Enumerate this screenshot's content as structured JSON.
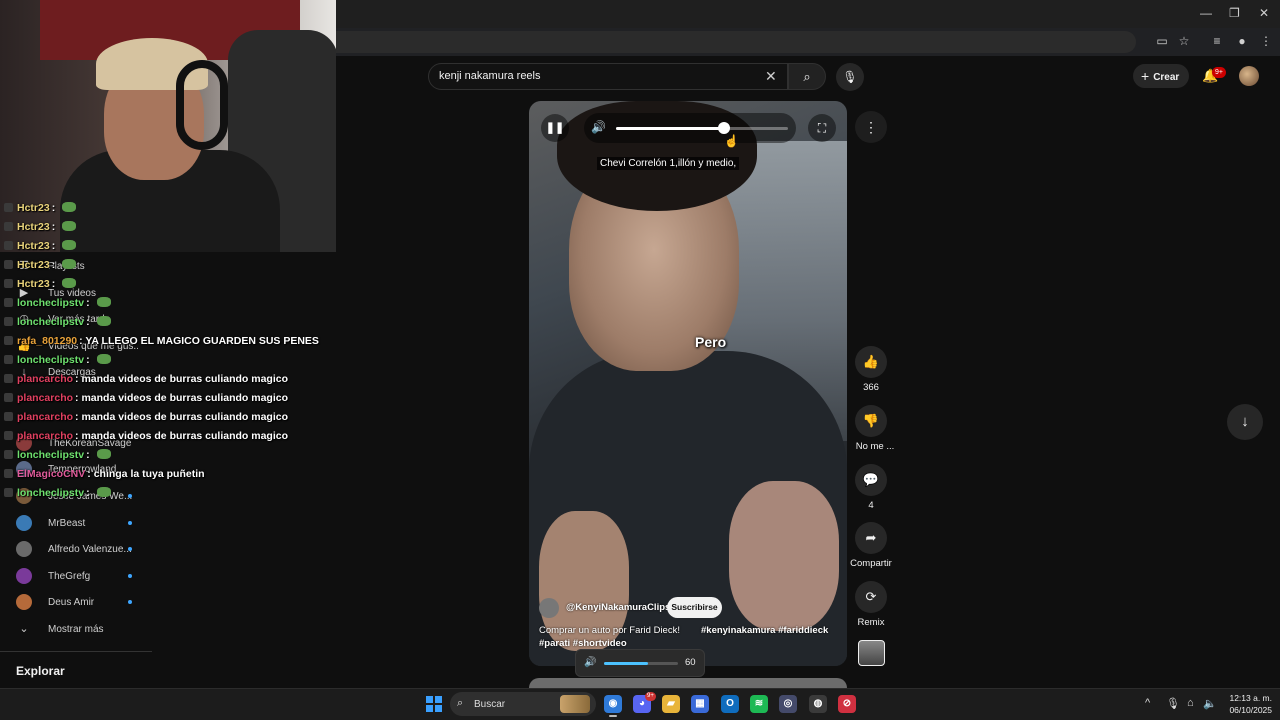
{
  "window": {
    "minimize": "—",
    "maximize": "❐",
    "close": "✕"
  },
  "search": {
    "query": "kenji nakamura reels",
    "clear_icon": "✕",
    "search_icon": "⌕",
    "mic_icon": "🎙"
  },
  "header": {
    "create_label": "Crear",
    "create_plus": "+",
    "notifications_badge": "9+"
  },
  "sidebar": {
    "items": [
      {
        "label": "Playlists",
        "icon": "☰"
      },
      {
        "label": "Tus videos",
        "icon": "▶"
      },
      {
        "label": "Ver más tarde",
        "icon": "◷"
      },
      {
        "label": "Videos que me gus...",
        "icon": "👍"
      },
      {
        "label": "Descargas",
        "icon": "↓"
      }
    ],
    "subscriptions": [
      {
        "label": "TheKoreanSavage",
        "color": "#8a3b3b"
      },
      {
        "label": "Temperrowland",
        "color": "#5a6a8a"
      },
      {
        "label": "Jesse James We...",
        "color": "#7a5a3a"
      },
      {
        "label": "MrBeast",
        "color": "#3a7ab5"
      },
      {
        "label": "Alfredo Valenzue...",
        "color": "#6a6a6a"
      },
      {
        "label": "TheGrefg",
        "color": "#7a3a9a"
      },
      {
        "label": "Deus Amir",
        "color": "#b56a3a"
      }
    ],
    "show_more": "Mostrar más",
    "show_more_icon": "⌄",
    "explore": "Explorar"
  },
  "chat": [
    {
      "user": "Hctr23",
      "color": "#e8d27a",
      "message": ""
    },
    {
      "user": "Hctr23",
      "color": "#e8d27a",
      "message": ""
    },
    {
      "user": "Hctr23",
      "color": "#e8d27a",
      "message": ""
    },
    {
      "user": "Hctr23",
      "color": "#e8d27a",
      "message": ""
    },
    {
      "user": "Hctr23",
      "color": "#e8d27a",
      "message": ""
    },
    {
      "user": "loncheclipstv",
      "color": "#6ee06e",
      "message": ""
    },
    {
      "user": "loncheclipstv",
      "color": "#6ee06e",
      "message": ""
    },
    {
      "user": "rafa_801290",
      "color": "#e8a23a",
      "message": "YA LLEGO EL MAGICO GUARDEN SUS PENES"
    },
    {
      "user": "loncheclipstv",
      "color": "#6ee06e",
      "message": ""
    },
    {
      "user": "plancarcho",
      "color": "#e04060",
      "message": "manda videos de burras culiando magico"
    },
    {
      "user": "plancarcho",
      "color": "#e04060",
      "message": "manda videos de burras culiando magico"
    },
    {
      "user": "plancarcho",
      "color": "#e04060",
      "message": "manda videos de burras culiando magico"
    },
    {
      "user": "plancarcho",
      "color": "#e04060",
      "message": "manda videos de burras culiando magico"
    },
    {
      "user": "loncheclipstv",
      "color": "#6ee06e",
      "message": ""
    },
    {
      "user": "ElMagicoCNV",
      "color": "#e05a9a",
      "message": "chinga la tuya puñetin"
    },
    {
      "user": "loncheclipstv",
      "color": "#6ee06e",
      "message": ""
    }
  ],
  "player": {
    "pause_icon": "❚❚",
    "volume_icon": "🔊",
    "fullscreen_icon": "⛶",
    "volume": 0.63,
    "caption": "Chevi Correlón 1,illón y medio,",
    "subtitle": "Pero",
    "more_icon": "⋮"
  },
  "video": {
    "channel": "@KenyiNakamuraClips",
    "subscribe_label": "Suscribirse",
    "description": "Comprar un auto por Farid Dieck!",
    "tags_1": "#kenyinakamura #fariddieck",
    "tags_2": "#parati #shortvideo"
  },
  "actions": {
    "like_icon": "👍",
    "like_count": "366",
    "dislike_icon": "👎",
    "dislike_label": "No me ...",
    "comment_icon": "💬",
    "comment_count": "4",
    "share_icon": "➦",
    "share_label": "Compartir",
    "remix_icon": "⟳",
    "remix_label": "Remix",
    "down_icon": "↓"
  },
  "os_volume": {
    "icon": "🔊",
    "value": "60",
    "level": 0.6
  },
  "taskbar": {
    "search_label": "Buscar",
    "search_icon": "⌕",
    "discord_badge": "9+",
    "time": "12:13 a. m.",
    "date": "06/10/2025",
    "tray_chevron": "^",
    "tray_mic": "🎙",
    "tray_net": "⌂",
    "tray_vol": "🔈",
    "apps": [
      {
        "name": "chrome",
        "color": "#2f7ad8",
        "glyph": "◉"
      },
      {
        "name": "discord",
        "color": "#5865f2",
        "glyph": "◕"
      },
      {
        "name": "files",
        "color": "#e8b43a",
        "glyph": "▰"
      },
      {
        "name": "store",
        "color": "#3a6ad8",
        "glyph": "▦"
      },
      {
        "name": "outlook",
        "color": "#0f6cbd",
        "glyph": "O"
      },
      {
        "name": "spotify",
        "color": "#1db954",
        "glyph": "≋"
      },
      {
        "name": "app7",
        "color": "#444a6a",
        "glyph": "◎"
      },
      {
        "name": "steam",
        "color": "#3a3a3a",
        "glyph": "◍"
      },
      {
        "name": "app9",
        "color": "#d03040",
        "glyph": "⊘"
      }
    ]
  }
}
